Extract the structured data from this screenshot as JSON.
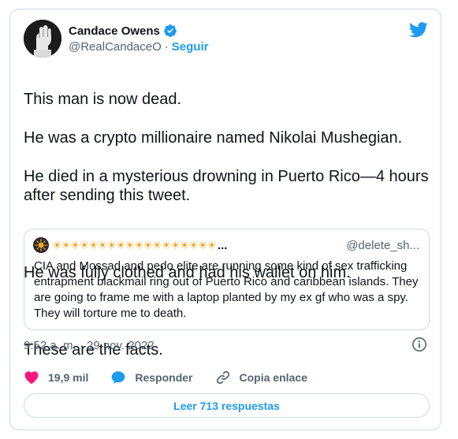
{
  "author": {
    "name": "Candace Owens",
    "handle": "@RealCandaceO",
    "separator": "·",
    "follow_label": "Seguir"
  },
  "tweet": {
    "lines": [
      "This man is now dead.",
      "He was a crypto millionaire named Nikolai Mushegian.",
      "He died in a mysterious drowning in Puerto Rico—4 hours after sending this tweet.",
      "",
      "He was fully clothed and had his wallet on him.",
      "",
      "These are the facts."
    ]
  },
  "quote": {
    "display_name": "☀☀☀☀☀☀☀☀☀☀☀☀☀☀☀☀☀☀",
    "ellipsis": "...",
    "handle": "@delete_sh...",
    "text": "CIA and Mossad and pedo elite are running some kind of sex trafficking entrapment blackmail ring out of Puerto Rico and caribbean islands. They are going to frame me with a laptop planted by my ex gf who was a spy. They will torture me to death."
  },
  "timestamp": "9:52 a. m. · 29 nov. 2022",
  "actions": {
    "like_count": "19,9 mil",
    "reply_label": "Responder",
    "copy_label": "Copia enlace"
  },
  "read_replies": "Leer 713 respuestas",
  "colors": {
    "accent": "#1d9bf0",
    "like": "#f91880",
    "text": "#0f1419",
    "secondary": "#536471",
    "border": "#cfd9de"
  },
  "icons": [
    "verified-badge-icon",
    "twitter-bird-icon",
    "info-icon",
    "heart-icon",
    "reply-bubble-icon",
    "link-icon",
    "sun-avatar-icon"
  ]
}
